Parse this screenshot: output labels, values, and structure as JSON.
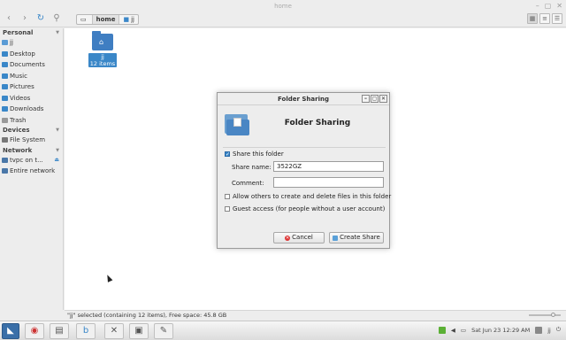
{
  "window": {
    "title": "home"
  },
  "toolbar": {
    "breadcrumbs": [
      {
        "label": ""
      },
      {
        "label": "home"
      },
      {
        "label": "jj"
      }
    ]
  },
  "sidebar": {
    "sections": [
      {
        "label": "Personal",
        "items": [
          {
            "label": "jj",
            "icon": "home-icon"
          },
          {
            "label": "Desktop",
            "icon": "desktop-icon"
          },
          {
            "label": "Documents",
            "icon": "documents-icon"
          },
          {
            "label": "Music",
            "icon": "music-icon"
          },
          {
            "label": "Pictures",
            "icon": "pictures-icon"
          },
          {
            "label": "Videos",
            "icon": "videos-icon"
          },
          {
            "label": "Downloads",
            "icon": "downloads-icon"
          },
          {
            "label": "Trash",
            "icon": "trash-icon"
          }
        ]
      },
      {
        "label": "Devices",
        "items": [
          {
            "label": "File System",
            "icon": "drive-icon"
          }
        ]
      },
      {
        "label": "Network",
        "items": [
          {
            "label": "tvpc on t...",
            "icon": "network-drive-icon"
          },
          {
            "label": "Entire network",
            "icon": "network-icon"
          }
        ]
      }
    ]
  },
  "files": [
    {
      "name": "jj",
      "info": "12 items"
    }
  ],
  "statusbar": {
    "text": "\"jj\" selected (containing 12 items), Free space: 45.8 GB"
  },
  "dialog": {
    "title": "Folder Sharing",
    "header": "Folder Sharing",
    "share_label": "Share this folder",
    "share_checked": true,
    "share_name_label": "Share name:",
    "share_name_value": "3522GZ",
    "comment_label": "Comment:",
    "comment_value": "",
    "allow_label": "Allow others to create and delete files in this folder",
    "allow_checked": false,
    "guest_label": "Guest access (for people without a user account)",
    "guest_checked": false,
    "cancel_label": "Cancel",
    "create_label": "Create Share"
  },
  "taskbar": {
    "clock": "Sat Jun 23 12:29 AM",
    "user": "jj"
  }
}
